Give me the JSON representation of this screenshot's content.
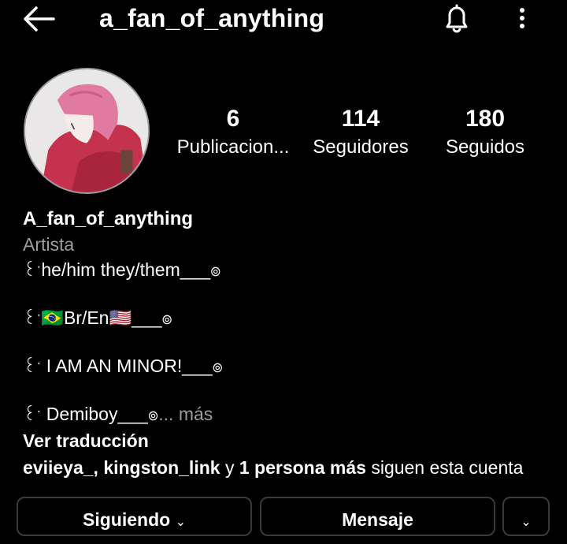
{
  "header": {
    "username": "a_fan_of_anything"
  },
  "stats": {
    "posts": {
      "value": "6",
      "label": "Publicacion..."
    },
    "followers": {
      "value": "114",
      "label": "Seguidores"
    },
    "following": {
      "value": "180",
      "label": "Seguidos"
    }
  },
  "profile": {
    "display_name": "A_fan_of_anything",
    "category": "Artista",
    "bio_lines": [
      {
        "prefix": "꒰ˑ",
        "text": "he/him they/them___",
        "suffix": "๏"
      },
      {
        "prefix": "꒰ˑ",
        "text": "🇧🇷Br/En🇺🇸___",
        "suffix": "๏"
      },
      {
        "prefix": "꒰ˑ",
        "text": " I AM AN MINOR!___",
        "suffix": "๏"
      },
      {
        "prefix": "꒰ˑ",
        "text": " Demiboy___",
        "suffix": "๏"
      }
    ],
    "more_label": "... más",
    "translate_label": "Ver traducción"
  },
  "followed_by": {
    "user1": "eviieya_",
    "sep1": ", ",
    "user2": "kingston_link",
    "conj": " y ",
    "others": "1 persona más",
    "tail": " siguen esta cuenta"
  },
  "buttons": {
    "following": "Siguiendo",
    "message": "Mensaje"
  },
  "icons": {
    "back": "arrow-left-icon",
    "notifications": "bell-icon",
    "more": "more-vertical-icon",
    "dropdown": "chevron-down-icon"
  }
}
